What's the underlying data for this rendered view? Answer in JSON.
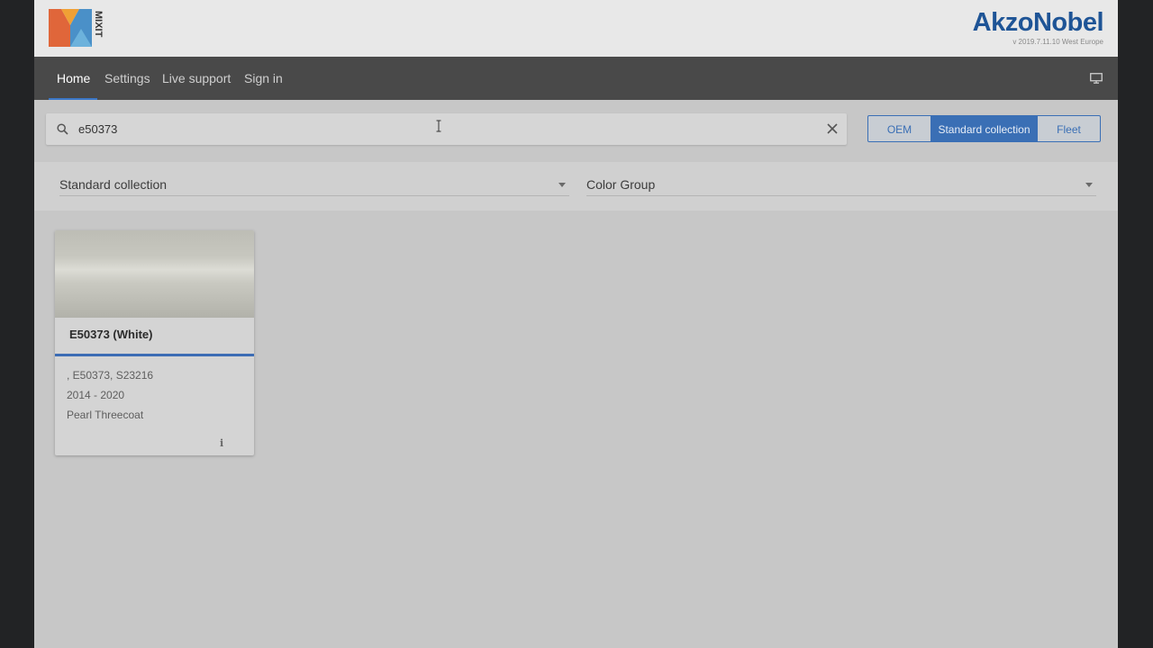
{
  "brand": {
    "app_logo_text": "MIXIT",
    "company": "AkzoNobel",
    "version": "v 2019.7.11.10 West Europe",
    "accent_color": "#1e5496"
  },
  "nav": {
    "items": [
      {
        "label": "Home",
        "active": true
      },
      {
        "label": "Settings",
        "active": false
      },
      {
        "label": "Live support",
        "active": false
      },
      {
        "label": "Sign in",
        "active": false
      }
    ],
    "right_icon": "monitor-icon"
  },
  "search": {
    "value": "e50373",
    "icon": "search-icon",
    "clear_icon": "close-icon"
  },
  "collection_toggle": {
    "options": [
      "OEM",
      "Standard collection",
      "Fleet"
    ],
    "selected": "Standard collection"
  },
  "filters": {
    "collection_select": "Standard collection",
    "color_group_select": "Color Group"
  },
  "results": [
    {
      "title": "E50373 (White)",
      "codes": ", E50373, S23216",
      "years": "2014 - 2020",
      "finish": "Pearl Threecoat",
      "info_icon": "info-icon"
    }
  ]
}
